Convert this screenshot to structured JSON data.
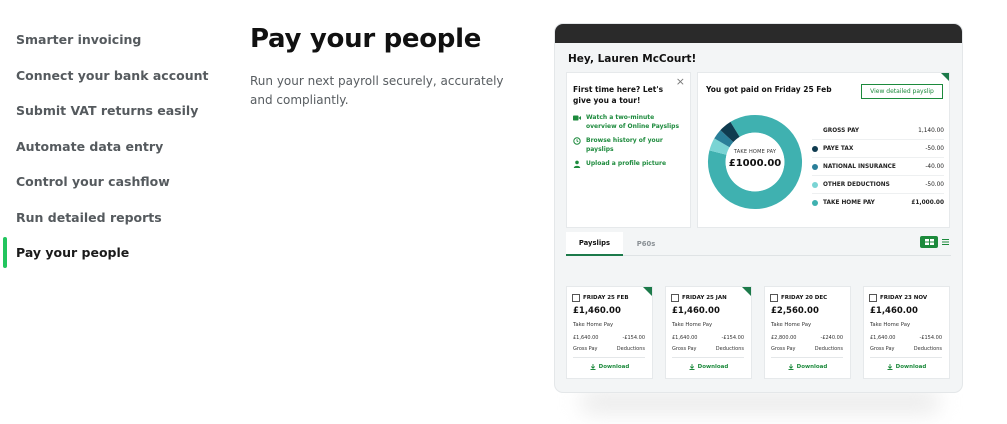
{
  "nav": {
    "items": [
      {
        "label": "Smarter invoicing"
      },
      {
        "label": "Connect your bank account"
      },
      {
        "label": "Submit VAT returns easily"
      },
      {
        "label": "Automate data entry"
      },
      {
        "label": "Control your cashflow"
      },
      {
        "label": "Run detailed reports"
      },
      {
        "label": "Pay your people"
      }
    ],
    "active_index": 6,
    "accent_color": "#22c55e"
  },
  "main": {
    "title": "Pay your people",
    "description": "Run your next payroll securely, accurately and compliantly."
  },
  "app": {
    "greeting": "Hey, Lauren McCourt!",
    "tour": {
      "close_glyph": "×",
      "title": "First time here? Let's give you a tour!",
      "links": [
        {
          "icon": "video-icon",
          "label": "Watch a two-minute overview of Online Payslips"
        },
        {
          "icon": "history-icon",
          "label": "Browse history of your payslips"
        },
        {
          "icon": "person-icon",
          "label": "Upload a profile picture"
        }
      ]
    },
    "pay": {
      "title": "You got paid on Friday 25 Feb",
      "detail_button": "View detailed payslip",
      "donut_label": "TAKE HOME PAY",
      "donut_value": "£1000.00",
      "breakdown": [
        {
          "label": "GROSS PAY",
          "value": "1,140.00",
          "color": ""
        },
        {
          "label": "PAYE TAX",
          "value": "-50.00",
          "color": "#0f3b4f"
        },
        {
          "label": "NATIONAL INSURANCE",
          "value": "-40.00",
          "color": "#2a7f99"
        },
        {
          "label": "OTHER DEDUCTIONS",
          "value": "-50.00",
          "color": "#7ad4d4"
        },
        {
          "label": "TAKE HOME PAY",
          "value": "£1,000.00",
          "color": "#3fb1b0"
        }
      ],
      "donut_segments": [
        {
          "color": "#3fb1b0",
          "value": 1000
        },
        {
          "color": "#7ad4d4",
          "value": 50
        },
        {
          "color": "#2a7f99",
          "value": 40
        },
        {
          "color": "#0f3b4f",
          "value": 50
        }
      ]
    },
    "tabs": [
      {
        "label": "Payslips",
        "active": true
      },
      {
        "label": "P60s",
        "active": false
      }
    ],
    "payslips": [
      {
        "date": "FRIDAY 25 FEB",
        "amount": "£1,460.00",
        "take_home_label": "Take Home Pay",
        "gross": "£1,640.00",
        "deductions": "-£154.00",
        "gross_label": "Gross Pay",
        "deductions_label": "Deductions",
        "download": "Download",
        "new": true
      },
      {
        "date": "FRIDAY 25 JAN",
        "amount": "£1,460.00",
        "take_home_label": "Take Home Pay",
        "gross": "£1,640.00",
        "deductions": "-£154.00",
        "gross_label": "Gross Pay",
        "deductions_label": "Deductions",
        "download": "Download",
        "new": true
      },
      {
        "date": "FRIDAY 20 DEC",
        "amount": "£2,560.00",
        "take_home_label": "Take Home Pay",
        "gross": "£2,800.00",
        "deductions": "-£240.00",
        "gross_label": "Gross Pay",
        "deductions_label": "Deductions",
        "download": "Download",
        "new": false
      },
      {
        "date": "FRIDAY 23 NOV",
        "amount": "£1,460.00",
        "take_home_label": "Take Home Pay",
        "gross": "£1,640.00",
        "deductions": "-£154.00",
        "gross_label": "Gross Pay",
        "deductions_label": "Deductions",
        "download": "Download",
        "new": false
      }
    ]
  }
}
